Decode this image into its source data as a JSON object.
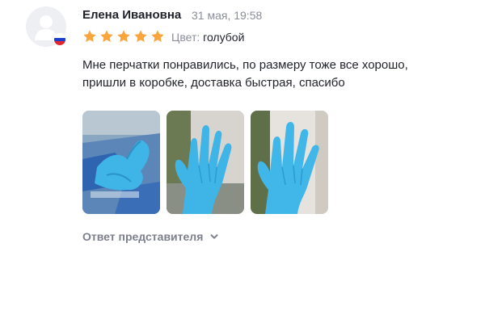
{
  "review": {
    "author": "Елена Ивановна",
    "date": "31 мая, 19:58",
    "rating": 5,
    "rating_max": 5,
    "attribute": {
      "label": "Цвет:",
      "value": "голубой"
    },
    "text_line1": "Мне перчатки понравились, по размеру тоже все хорошо,",
    "text_line2": "пришли в коробке, доставка быстрая, спасибо",
    "photos": [
      "gloves-in-box-photo",
      "glove-hand-photo",
      "glove-hand-photo"
    ],
    "reply_toggle": "Ответ представителя"
  },
  "colors": {
    "star": "#f9a53c",
    "muted": "#8b8e99",
    "reply": "#7c7f8c",
    "glove": "#3fb4e6"
  }
}
